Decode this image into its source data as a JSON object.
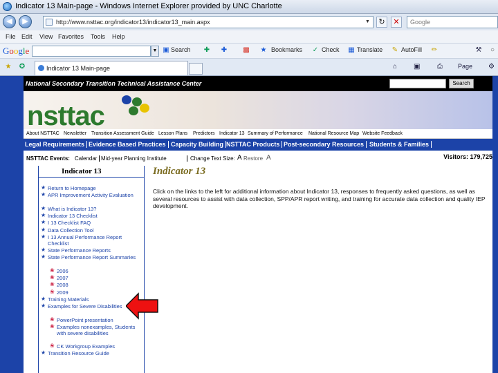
{
  "browser": {
    "title": "Indicator 13 Main-page - Windows Internet Explorer provided by UNC Charlotte",
    "url": "http://www.nsttac.org/indicator13/indicator13_main.aspx",
    "search_placeholder": "Google",
    "menu": [
      "File",
      "Edit",
      "View",
      "Favorites",
      "Tools",
      "Help"
    ],
    "google_toolbar": {
      "logo": "Google",
      "search_label": "Search",
      "bookmarks_label": "Bookmarks",
      "check_label": "Check",
      "translate_label": "Translate",
      "autofill_label": "AutoFill"
    },
    "tab_title": "Indicator 13 Main-page",
    "page_menu_label": "Page"
  },
  "site": {
    "org_name": "National Secondary Transition Technical Assistance Center",
    "search_button": "Search",
    "logo": "nsttac",
    "top_nav": [
      "About NSTTAC",
      "Newsletter",
      "Transition Assessment Guide",
      "Lesson Plans",
      "Predictors",
      "Indicator 13",
      "Summary of Performance",
      "National Resource Map",
      "Website Feedback"
    ],
    "main_nav": [
      "Legal Requirements",
      "Evidence Based Practices",
      "Capacity Building",
      "NSTTAC Products",
      "Post-secondary Resources",
      "Students & Families"
    ],
    "events_label": "NSTTAC Events:",
    "events_links": [
      "Calendar",
      "Mid-year Planning Institute"
    ],
    "text_size_label": "Change Text Size:",
    "text_size_large": "A",
    "text_size_restore": "Restore",
    "text_size_small": "A",
    "visitors": "Visitors: 179,725"
  },
  "sidebar": {
    "heading": "Indicator 13",
    "items": [
      {
        "label": "Return to Homepage",
        "level": 1
      },
      {
        "label": "APR Improvement Activity Evaluation",
        "level": 1
      },
      {
        "label": "What is Indicator 13?",
        "level": 1
      },
      {
        "label": "Indicator 13 Checklist",
        "level": 1
      },
      {
        "label": "I 13 Checklist FAQ",
        "level": 1
      },
      {
        "label": "Data Collection Tool",
        "level": 1
      },
      {
        "label": "I 13 Annual Performance Report Checklist",
        "level": 1
      },
      {
        "label": "State Performance Reports",
        "level": 1
      },
      {
        "label": "State Performance Report Summaries",
        "level": 1
      },
      {
        "label": "2006",
        "level": 2
      },
      {
        "label": "2007",
        "level": 2
      },
      {
        "label": "2008",
        "level": 2
      },
      {
        "label": "2009",
        "level": 2
      },
      {
        "label": "Training Materials",
        "level": 1
      },
      {
        "label": "Examples for Severe Disabilities",
        "level": 1
      },
      {
        "label": "PowerPoint presentation",
        "level": 2
      },
      {
        "label": "Examples nonexamples, Students with severe disabilities",
        "level": 2
      },
      {
        "label": "CK Workgroup Examples",
        "level": 2
      },
      {
        "label": "Transition Resource Guide",
        "level": 1
      }
    ]
  },
  "main": {
    "title": "Indicator 13",
    "text": "Click on the links to the left for additional information about Indicator 13, responses to frequently asked questions, as well as several resources to assist with data collection, SPP/APR report writing, and training for accurate data collection and quality IEP development."
  },
  "colors": {
    "site_blue": "#1c43a8",
    "logo_green": "#2d7a2e",
    "title_olive": "#7a6b1f",
    "arrow_red": "#ee1111"
  }
}
